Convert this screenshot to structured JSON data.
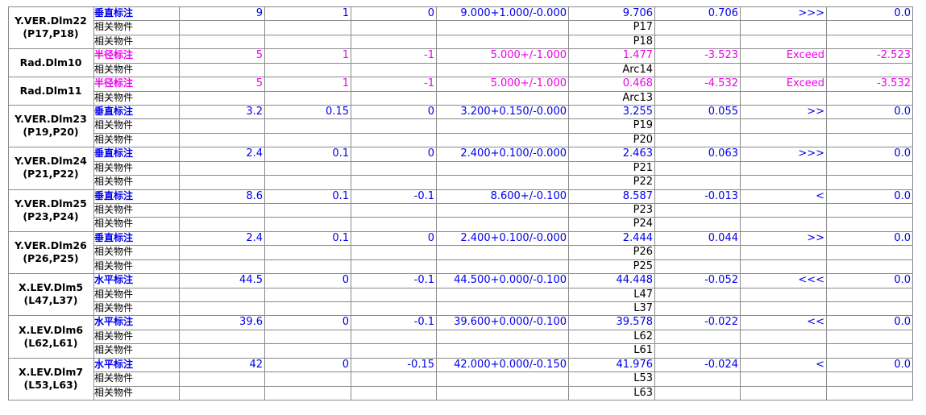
{
  "colors": {
    "blue": "#0000ee",
    "magenta": "#ee00ee",
    "black": "#000000",
    "grid": "#8a8a8a"
  },
  "groups": [
    {
      "label1": "Y.VER.Dlm22",
      "label2": "(P17,P18)",
      "color": "blue",
      "type_label": "垂直标注",
      "nominal": "9",
      "upper": "1",
      "lower": "0",
      "tolerance": "9.000+1.000/-0.000",
      "measured": "9.706",
      "deviation": "0.706",
      "indicator": ">>>",
      "out_of_tol": "0.0",
      "related": [
        {
          "label": "相关物件",
          "name": "P17"
        },
        {
          "label": "相关物件",
          "name": "P18"
        }
      ]
    },
    {
      "label1": "Rad.Dlm10",
      "label2": "",
      "color": "magenta",
      "type_label": "半径标注",
      "nominal": "5",
      "upper": "1",
      "lower": "-1",
      "tolerance": "5.000+/-1.000",
      "measured": "1.477",
      "deviation": "-3.523",
      "indicator": "Exceed",
      "out_of_tol": "-2.523",
      "related": [
        {
          "label": "相关物件",
          "name": "Arc14"
        }
      ]
    },
    {
      "label1": "Rad.Dlm11",
      "label2": "",
      "color": "magenta",
      "type_label": "半径标注",
      "nominal": "5",
      "upper": "1",
      "lower": "-1",
      "tolerance": "5.000+/-1.000",
      "measured": "0.468",
      "deviation": "-4.532",
      "indicator": "Exceed",
      "out_of_tol": "-3.532",
      "related": [
        {
          "label": "相关物件",
          "name": "Arc13"
        }
      ]
    },
    {
      "label1": "Y.VER.Dlm23",
      "label2": "(P19,P20)",
      "color": "blue",
      "type_label": "垂直标注",
      "nominal": "3.2",
      "upper": "0.15",
      "lower": "0",
      "tolerance": "3.200+0.150/-0.000",
      "measured": "3.255",
      "deviation": "0.055",
      "indicator": ">>",
      "out_of_tol": "0.0",
      "related": [
        {
          "label": "相关物件",
          "name": "P19"
        },
        {
          "label": "相关物件",
          "name": "P20"
        }
      ]
    },
    {
      "label1": "Y.VER.Dlm24",
      "label2": "(P21,P22)",
      "color": "blue",
      "type_label": "垂直标注",
      "nominal": "2.4",
      "upper": "0.1",
      "lower": "0",
      "tolerance": "2.400+0.100/-0.000",
      "measured": "2.463",
      "deviation": "0.063",
      "indicator": ">>>",
      "out_of_tol": "0.0",
      "related": [
        {
          "label": "相关物件",
          "name": "P21"
        },
        {
          "label": "相关物件",
          "name": "P22"
        }
      ]
    },
    {
      "label1": "Y.VER.Dlm25",
      "label2": "(P23,P24)",
      "color": "blue",
      "type_label": "垂直标注",
      "nominal": "8.6",
      "upper": "0.1",
      "lower": "-0.1",
      "tolerance": "8.600+/-0.100",
      "measured": "8.587",
      "deviation": "-0.013",
      "indicator": "<",
      "out_of_tol": "0.0",
      "related": [
        {
          "label": "相关物件",
          "name": "P23"
        },
        {
          "label": "相关物件",
          "name": "P24"
        }
      ]
    },
    {
      "label1": "Y.VER.Dlm26",
      "label2": "(P26,P25)",
      "color": "blue",
      "type_label": "垂直标注",
      "nominal": "2.4",
      "upper": "0.1",
      "lower": "0",
      "tolerance": "2.400+0.100/-0.000",
      "measured": "2.444",
      "deviation": "0.044",
      "indicator": ">>",
      "out_of_tol": "0.0",
      "related": [
        {
          "label": "相关物件",
          "name": "P26"
        },
        {
          "label": "相关物件",
          "name": "P25"
        }
      ]
    },
    {
      "label1": "X.LEV.Dlm5",
      "label2": "(L47,L37)",
      "color": "blue",
      "type_label": "水平标注",
      "nominal": "44.5",
      "upper": "0",
      "lower": "-0.1",
      "tolerance": "44.500+0.000/-0.100",
      "measured": "44.448",
      "deviation": "-0.052",
      "indicator": "<<<",
      "out_of_tol": "0.0",
      "related": [
        {
          "label": "相关物件",
          "name": "L47"
        },
        {
          "label": "相关物件",
          "name": "L37"
        }
      ]
    },
    {
      "label1": "X.LEV.Dlm6",
      "label2": "(L62,L61)",
      "color": "blue",
      "type_label": "水平标注",
      "nominal": "39.6",
      "upper": "0",
      "lower": "-0.1",
      "tolerance": "39.600+0.000/-0.100",
      "measured": "39.578",
      "deviation": "-0.022",
      "indicator": "<<",
      "out_of_tol": "0.0",
      "related": [
        {
          "label": "相关物件",
          "name": "L62"
        },
        {
          "label": "相关物件",
          "name": "L61"
        }
      ]
    },
    {
      "label1": "X.LEV.Dlm7",
      "label2": "(L53,L63)",
      "color": "blue",
      "type_label": "水平标注",
      "nominal": "42",
      "upper": "0",
      "lower": "-0.15",
      "tolerance": "42.000+0.000/-0.150",
      "measured": "41.976",
      "deviation": "-0.024",
      "indicator": "<",
      "out_of_tol": "0.0",
      "related": [
        {
          "label": "相关物件",
          "name": "L53"
        },
        {
          "label": "相关物件",
          "name": "L63"
        }
      ]
    }
  ]
}
